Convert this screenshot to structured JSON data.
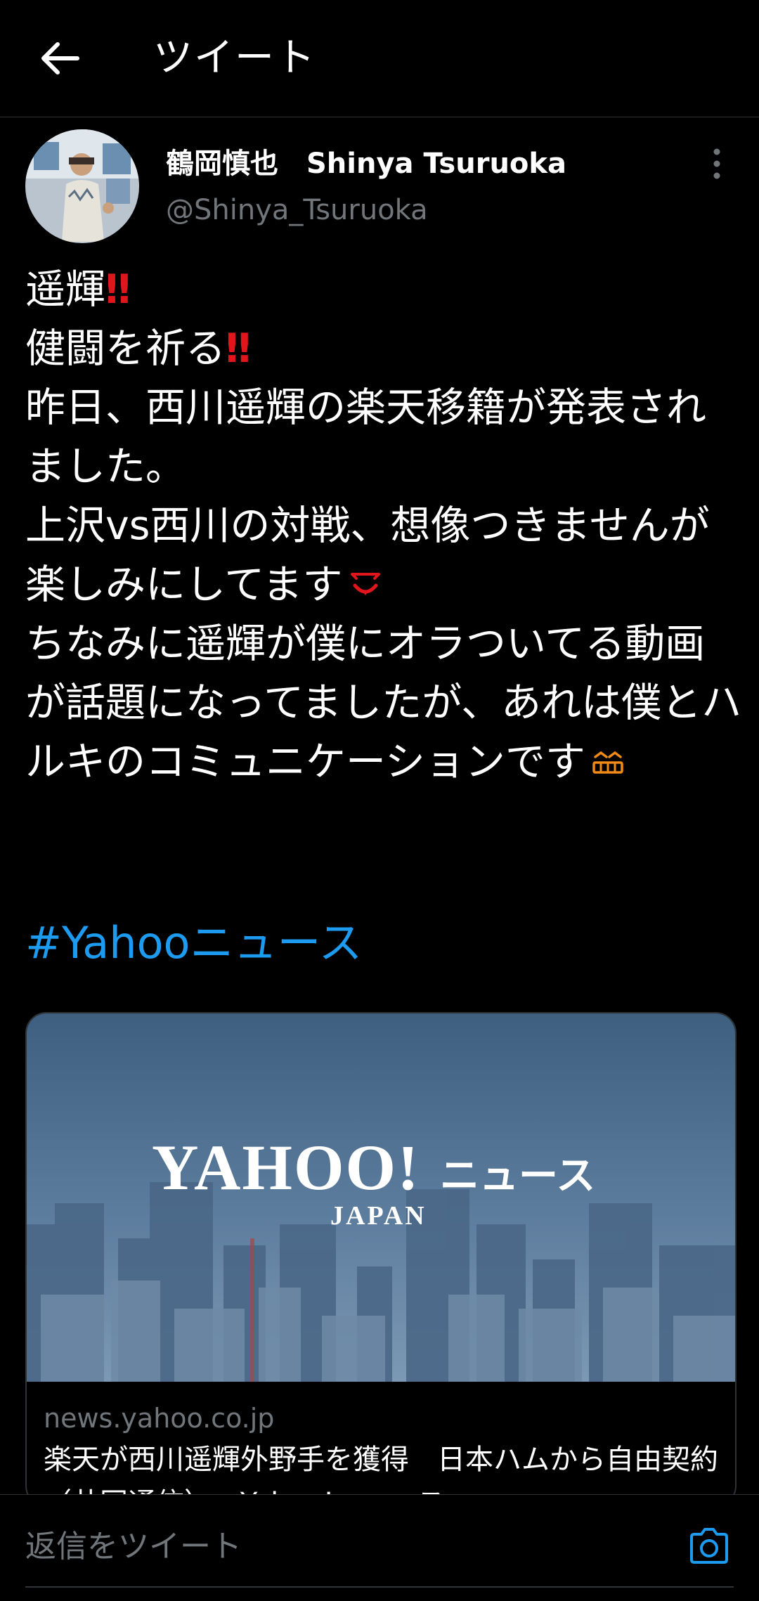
{
  "header": {
    "title": "ツイート"
  },
  "tweet": {
    "display_name": "鶴岡慎也　Shinya Tsuruoka",
    "handle": "@Shinya_Tsuruoka",
    "lines": [
      "遥輝",
      "健闘を祈る",
      "昨日、西川遥輝の楽天移籍が発表されました。",
      "上沢vs西川の対戦、想像つきませんが楽しみにしてます",
      "ちなみに遥輝が僕にオラついてる動画が話題になってましたが、あれは僕とハルキのコミュニケーションです"
    ],
    "emoji": {
      "bang": "‼"
    },
    "hashtag": "#Yahooニュース"
  },
  "card": {
    "logo_main": "YAHOO!",
    "logo_sub": "JAPAN",
    "logo_news": "ニュース",
    "domain": "news.yahoo.co.jp",
    "title": "楽天が西川遥輝外野手を獲得　日本ハムから自由契約（共同通信） - Yahoo!ニュース"
  },
  "reply": {
    "placeholder": "返信をツイート"
  },
  "colors": {
    "accent": "#1d9bf0",
    "muted": "#71767b",
    "bang": "#e0161c"
  }
}
